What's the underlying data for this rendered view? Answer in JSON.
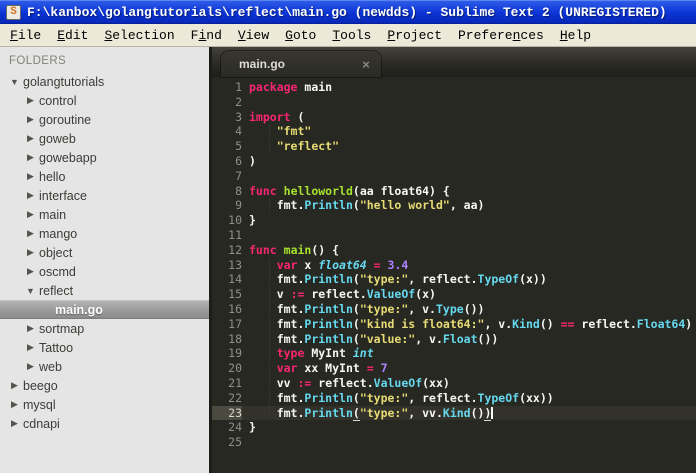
{
  "window": {
    "title": "F:\\kanbox\\golangtutorials\\reflect\\main.go (newdds) - Sublime Text 2 (UNREGISTERED)",
    "app_icon_glyph": "S"
  },
  "menu": {
    "items": [
      {
        "label": "File",
        "underline": 0
      },
      {
        "label": "Edit",
        "underline": 0
      },
      {
        "label": "Selection",
        "underline": 0
      },
      {
        "label": "Find",
        "underline": 1
      },
      {
        "label": "View",
        "underline": 0
      },
      {
        "label": "Goto",
        "underline": 0
      },
      {
        "label": "Tools",
        "underline": 0
      },
      {
        "label": "Project",
        "underline": 0
      },
      {
        "label": "Preferences",
        "underline": 7
      },
      {
        "label": "Help",
        "underline": 0
      }
    ]
  },
  "sidebar": {
    "header": "FOLDERS",
    "items": [
      {
        "label": "golangtutorials",
        "depth": 0,
        "kind": "expanded",
        "selected": false
      },
      {
        "label": "control",
        "depth": 1,
        "kind": "collapsed",
        "selected": false
      },
      {
        "label": "goroutine",
        "depth": 1,
        "kind": "collapsed",
        "selected": false
      },
      {
        "label": "goweb",
        "depth": 1,
        "kind": "collapsed",
        "selected": false
      },
      {
        "label": "gowebapp",
        "depth": 1,
        "kind": "collapsed",
        "selected": false
      },
      {
        "label": "hello",
        "depth": 1,
        "kind": "collapsed",
        "selected": false
      },
      {
        "label": "interface",
        "depth": 1,
        "kind": "collapsed",
        "selected": false
      },
      {
        "label": "main",
        "depth": 1,
        "kind": "collapsed",
        "selected": false
      },
      {
        "label": "mango",
        "depth": 1,
        "kind": "collapsed",
        "selected": false
      },
      {
        "label": "object",
        "depth": 1,
        "kind": "collapsed",
        "selected": false
      },
      {
        "label": "oscmd",
        "depth": 1,
        "kind": "collapsed",
        "selected": false
      },
      {
        "label": "reflect",
        "depth": 1,
        "kind": "expanded",
        "selected": false
      },
      {
        "label": "main.go",
        "depth": 2,
        "kind": "file",
        "selected": true
      },
      {
        "label": "sortmap",
        "depth": 1,
        "kind": "collapsed",
        "selected": false
      },
      {
        "label": "Tattoo",
        "depth": 1,
        "kind": "collapsed",
        "selected": false
      },
      {
        "label": "web",
        "depth": 1,
        "kind": "collapsed",
        "selected": false
      },
      {
        "label": "beego",
        "depth": 0,
        "kind": "collapsed",
        "selected": false
      },
      {
        "label": "mysql",
        "depth": 0,
        "kind": "collapsed",
        "selected": false
      },
      {
        "label": "cdnapi",
        "depth": 0,
        "kind": "collapsed",
        "selected": false
      }
    ],
    "arrow_glyphs": {
      "expanded": "▼",
      "collapsed": "▶"
    }
  },
  "tabbar": {
    "tabs": [
      {
        "label": "main.go",
        "close_glyph": "×",
        "active": true
      }
    ]
  },
  "editor": {
    "language": "Go",
    "current_line": 23,
    "caret": {
      "line": 23,
      "position": "end-of-line"
    },
    "lines": [
      {
        "num": 1,
        "segments": [
          [
            "k",
            "package"
          ],
          [
            "p",
            " main"
          ]
        ]
      },
      {
        "num": 2,
        "segments": []
      },
      {
        "num": 3,
        "segments": [
          [
            "k",
            "import"
          ],
          [
            "p",
            " ("
          ]
        ]
      },
      {
        "num": 4,
        "segments": [
          [
            "ind",
            "    "
          ],
          [
            "s",
            "\"fmt\""
          ]
        ]
      },
      {
        "num": 5,
        "segments": [
          [
            "ind",
            "    "
          ],
          [
            "s",
            "\"reflect\""
          ]
        ]
      },
      {
        "num": 6,
        "segments": [
          [
            "p",
            ")"
          ]
        ]
      },
      {
        "num": 7,
        "segments": []
      },
      {
        "num": 8,
        "segments": [
          [
            "k",
            "func"
          ],
          [
            "p",
            " "
          ],
          [
            "fn",
            "helloworld"
          ],
          [
            "p",
            "(aa float64) {"
          ]
        ]
      },
      {
        "num": 9,
        "segments": [
          [
            "ind",
            "    "
          ],
          [
            "p",
            "fmt."
          ],
          [
            "lib",
            "Println"
          ],
          [
            "p",
            "("
          ],
          [
            "s",
            "\"hello world\""
          ],
          [
            "p",
            ", aa)"
          ]
        ]
      },
      {
        "num": 10,
        "segments": [
          [
            "p",
            "}"
          ]
        ]
      },
      {
        "num": 11,
        "segments": []
      },
      {
        "num": 12,
        "segments": [
          [
            "k",
            "func"
          ],
          [
            "p",
            " "
          ],
          [
            "fn",
            "main"
          ],
          [
            "p",
            "() {"
          ]
        ]
      },
      {
        "num": 13,
        "segments": [
          [
            "ind",
            "    "
          ],
          [
            "k",
            "var"
          ],
          [
            "p",
            " x "
          ],
          [
            "t",
            "float64"
          ],
          [
            "p",
            " "
          ],
          [
            "o",
            "="
          ],
          [
            "p",
            " "
          ],
          [
            "n",
            "3.4"
          ]
        ]
      },
      {
        "num": 14,
        "segments": [
          [
            "ind",
            "    "
          ],
          [
            "p",
            "fmt."
          ],
          [
            "lib",
            "Println"
          ],
          [
            "p",
            "("
          ],
          [
            "s",
            "\"type:\""
          ],
          [
            "p",
            ", reflect."
          ],
          [
            "lib",
            "TypeOf"
          ],
          [
            "p",
            "(x))"
          ]
        ]
      },
      {
        "num": 15,
        "segments": [
          [
            "ind",
            "    "
          ],
          [
            "p",
            "v "
          ],
          [
            "o",
            ":="
          ],
          [
            "p",
            " reflect."
          ],
          [
            "lib",
            "ValueOf"
          ],
          [
            "p",
            "(x)"
          ]
        ]
      },
      {
        "num": 16,
        "segments": [
          [
            "ind",
            "    "
          ],
          [
            "p",
            "fmt."
          ],
          [
            "lib",
            "Println"
          ],
          [
            "p",
            "("
          ],
          [
            "s",
            "\"type:\""
          ],
          [
            "p",
            ", v."
          ],
          [
            "lib",
            "Type"
          ],
          [
            "p",
            "())"
          ]
        ]
      },
      {
        "num": 17,
        "segments": [
          [
            "ind",
            "    "
          ],
          [
            "p",
            "fmt."
          ],
          [
            "lib",
            "Println"
          ],
          [
            "p",
            "("
          ],
          [
            "s",
            "\"kind is float64:\""
          ],
          [
            "p",
            ", v."
          ],
          [
            "lib",
            "Kind"
          ],
          [
            "p",
            "() "
          ],
          [
            "o",
            "=="
          ],
          [
            "p",
            " reflect."
          ],
          [
            "lib",
            "Float64"
          ],
          [
            "p",
            ")"
          ]
        ]
      },
      {
        "num": 18,
        "segments": [
          [
            "ind",
            "    "
          ],
          [
            "p",
            "fmt."
          ],
          [
            "lib",
            "Println"
          ],
          [
            "p",
            "("
          ],
          [
            "s",
            "\"value:\""
          ],
          [
            "p",
            ", v."
          ],
          [
            "lib",
            "Float"
          ],
          [
            "p",
            "())"
          ]
        ]
      },
      {
        "num": 19,
        "segments": [
          [
            "ind",
            "    "
          ],
          [
            "k",
            "type"
          ],
          [
            "p",
            " MyInt "
          ],
          [
            "t",
            "int"
          ]
        ]
      },
      {
        "num": 20,
        "segments": [
          [
            "ind",
            "    "
          ],
          [
            "k",
            "var"
          ],
          [
            "p",
            " xx MyInt "
          ],
          [
            "o",
            "="
          ],
          [
            "p",
            " "
          ],
          [
            "n",
            "7"
          ]
        ]
      },
      {
        "num": 21,
        "segments": [
          [
            "ind",
            "    "
          ],
          [
            "p",
            "vv "
          ],
          [
            "o",
            ":="
          ],
          [
            "p",
            " reflect."
          ],
          [
            "lib",
            "ValueOf"
          ],
          [
            "p",
            "(xx)"
          ]
        ]
      },
      {
        "num": 22,
        "segments": [
          [
            "ind",
            "    "
          ],
          [
            "p",
            "fmt."
          ],
          [
            "lib",
            "Println"
          ],
          [
            "p",
            "("
          ],
          [
            "s",
            "\"type:\""
          ],
          [
            "p",
            ", reflect."
          ],
          [
            "lib",
            "TypeOf"
          ],
          [
            "p",
            "(xx))"
          ]
        ]
      },
      {
        "num": 23,
        "segments": [
          [
            "ind",
            "    "
          ],
          [
            "p",
            "fmt."
          ],
          [
            "lib",
            "Println"
          ],
          [
            "bm",
            "("
          ],
          [
            "s",
            "\"type:\""
          ],
          [
            "p",
            ", vv."
          ],
          [
            "lib",
            "Kind"
          ],
          [
            "p",
            "()"
          ],
          [
            "bm",
            ")"
          ]
        ]
      },
      {
        "num": 24,
        "segments": [
          [
            "p",
            "}"
          ]
        ]
      },
      {
        "num": 25,
        "segments": []
      }
    ]
  },
  "colors": {
    "titlebar_blue": "#0B34D6",
    "menubar_bg": "#ECE9D8",
    "sidebar_bg": "#E5E5E5",
    "sidebar_selected": "#9C9C9C",
    "editor_bg": "#272822",
    "current_line_bg": "#33322A",
    "gutter_text": "#8F908A",
    "keyword": "#F92672",
    "string": "#E6DB74",
    "type_italic": "#66D9EF",
    "function_call": "#66D9EF",
    "function_def": "#A6E22E",
    "number": "#AE81FF",
    "plain_text": "#F8F8F2"
  }
}
